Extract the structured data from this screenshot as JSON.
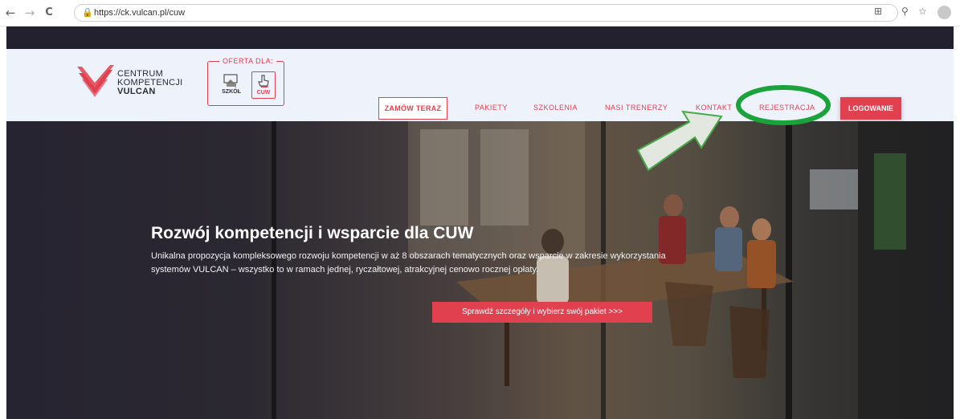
{
  "browser": {
    "url": "https://ck.vulcan.pl/cuw",
    "back_icon": "←",
    "forward_icon": "→",
    "reload_icon": "C",
    "lock_icon": "🔒",
    "qr_icon": "⊞",
    "zoom_icon": "⚲",
    "star_icon": "☆",
    "profile_icon": "●"
  },
  "logo": {
    "line1": "CENTRUM",
    "line2": "KOMPETENCJI",
    "line3": "VULCAN",
    "color": "#e1414f"
  },
  "offer": {
    "label": "OFERTA DLA:",
    "items": [
      {
        "label": "SZKÓŁ"
      },
      {
        "label": "CUW"
      }
    ]
  },
  "nav": {
    "order_button": "ZAMÓW TERAZ",
    "items": [
      {
        "label": "PAKIETY"
      },
      {
        "label": "SZKOLENIA"
      },
      {
        "label": "NASI TRENERZY"
      },
      {
        "label": "KONTAKT"
      },
      {
        "label": "REJESTRACJA"
      }
    ],
    "login_button": "LOGOWANIE"
  },
  "hero": {
    "title": "Rozwój kompetencji i wsparcie dla CUW",
    "subtitle": "Unikalna propozycja kompleksowego rozwoju kompetencji w aż 8 obszarach tematycznych oraz wsparcie w zakresie wykorzystania systemów VULCAN – wszystko to w ramach jednej, ryczałtowej, atrakcyjnej cenowo rocznej opłaty.",
    "cta": "Sprawdź szczegóły i wybierz swój pakiet >>>"
  },
  "colors": {
    "accent": "#e1414f",
    "annotation_green": "#1aa33a",
    "header_bg": "#eef2fb",
    "top_strip": "#23212f"
  }
}
